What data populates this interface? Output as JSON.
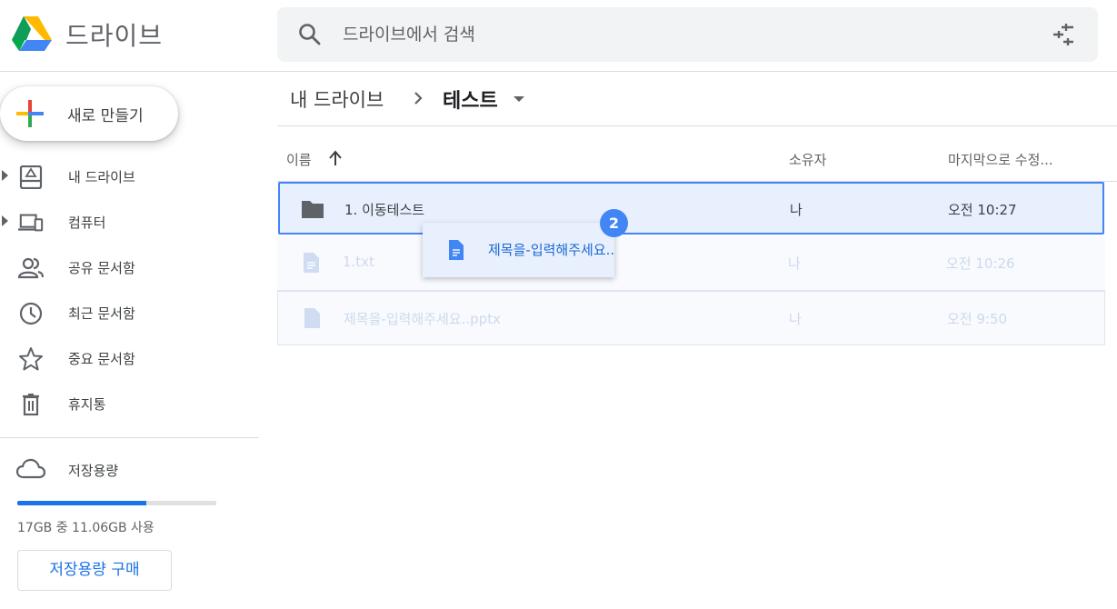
{
  "app": {
    "title": "드라이브"
  },
  "search": {
    "placeholder": "드라이브에서 검색"
  },
  "new_button": {
    "label": "새로 만들기"
  },
  "sidebar": {
    "items": [
      {
        "label": "내 드라이브",
        "icon": "my-drive-icon"
      },
      {
        "label": "컴퓨터",
        "icon": "computers-icon"
      },
      {
        "label": "공유 문서함",
        "icon": "shared-icon"
      },
      {
        "label": "최근 문서함",
        "icon": "recent-icon"
      },
      {
        "label": "중요 문서함",
        "icon": "star-icon"
      },
      {
        "label": "휴지통",
        "icon": "trash-icon"
      }
    ],
    "storage": {
      "label": "저장용량",
      "usage_text": "17GB 중 11.06GB 사용",
      "used_fraction": 0.65,
      "buy_label": "저장용량 구매"
    }
  },
  "breadcrumb": {
    "root": "내 드라이브",
    "current": "테스트"
  },
  "table": {
    "headers": {
      "name": "이름",
      "owner": "소유자",
      "modified": "마지막으로 수정..."
    },
    "rows": [
      {
        "name": "1. 이동테스트",
        "owner": "나",
        "modified": "오전 10:27",
        "type": "folder",
        "state": "selected"
      },
      {
        "name": "1.txt",
        "owner": "나",
        "modified": "오전 10:26",
        "type": "doc",
        "state": "dragging"
      },
      {
        "name": "제목을-입력해주세요..pptx",
        "owner": "나",
        "modified": "오전 9:50",
        "type": "file",
        "state": "dragging"
      }
    ]
  },
  "drag": {
    "label": "제목을-입력해주세요..pptx",
    "count": "2"
  },
  "colors": {
    "accent": "#1a73e8",
    "selection_bg": "#e8f0fe",
    "selection_border": "#4285f4"
  }
}
